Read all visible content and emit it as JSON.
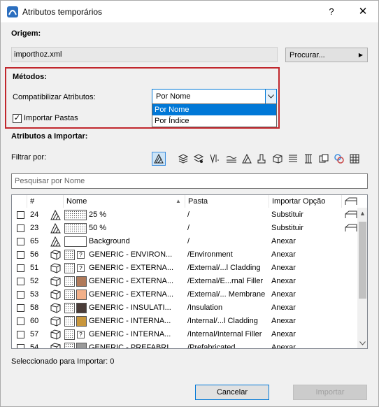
{
  "window": {
    "title": "Atributos temporários",
    "help": "?",
    "close": "✕"
  },
  "origin": {
    "heading": "Origem:",
    "file": "importhoz.xml",
    "browse_label": "Procurar..."
  },
  "methods": {
    "heading": "Métodos:",
    "match_label": "Compatibilizar Atributos:",
    "selected": "Por Nome",
    "options": [
      "Por Nome",
      "Por Índice"
    ],
    "import_folders_label": "Importar Pastas",
    "import_folders_checked": true
  },
  "import": {
    "heading": "Atributos a Importar:",
    "filter_label": "Filtrar por:",
    "search_placeholder": "Pesquisar por Nome",
    "columns": {
      "number": "#",
      "name": "Nome",
      "folder": "Pasta",
      "option": "Importar Opção"
    },
    "rows": [
      {
        "num": "24",
        "name": "25 %",
        "folder": "/",
        "option": "Substituir",
        "type": "fill",
        "swatch": "dots"
      },
      {
        "num": "23",
        "name": "50 %",
        "folder": "/",
        "option": "Substituir",
        "type": "fill",
        "swatch": "dots"
      },
      {
        "num": "65",
        "name": "Background",
        "folder": "/",
        "option": "Anexar",
        "type": "fill",
        "swatch": "white"
      },
      {
        "num": "56",
        "name": "GENERIC - ENVIRON...",
        "folder": "/Environment",
        "option": "Anexar",
        "type": "building",
        "swatch": "#ffffff"
      },
      {
        "num": "51",
        "name": "GENERIC - EXTERNA...",
        "folder": "/External/...l Cladding",
        "option": "Anexar",
        "type": "building",
        "swatch": "#ffffff"
      },
      {
        "num": "52",
        "name": "GENERIC - EXTERNA...",
        "folder": "/External/E...rnal Filler",
        "option": "Anexar",
        "type": "building",
        "swatch": "#b07a5a"
      },
      {
        "num": "53",
        "name": "GENERIC - EXTERNA...",
        "folder": "/External/... Membrane",
        "option": "Anexar",
        "type": "building",
        "swatch": "#f2b089"
      },
      {
        "num": "58",
        "name": "GENERIC - INSULATI...",
        "folder": "/Insulation",
        "option": "Anexar",
        "type": "building",
        "swatch": "#4a3c38"
      },
      {
        "num": "60",
        "name": "GENERIC - INTERNA...",
        "folder": "/Internal/...l Cladding",
        "option": "Anexar",
        "type": "building",
        "swatch": "#c8963c"
      },
      {
        "num": "57",
        "name": "GENERIC - INTERNA...",
        "folder": "/Internal/Internal Filler",
        "option": "Anexar",
        "type": "building",
        "swatch": "#ffffff"
      },
      {
        "num": "54",
        "name": "GENERIC - PREFABRI...",
        "folder": "/Prefabricated",
        "option": "Anexar",
        "type": "building",
        "swatch": "#9a9a9a"
      }
    ],
    "selected_status": "Seleccionado para Importar: 0"
  },
  "footer": {
    "cancel_label": "Cancelar",
    "import_label": "Importar"
  },
  "colors": {
    "highlight_border": "#c1272d",
    "accent": "#0078d7"
  }
}
